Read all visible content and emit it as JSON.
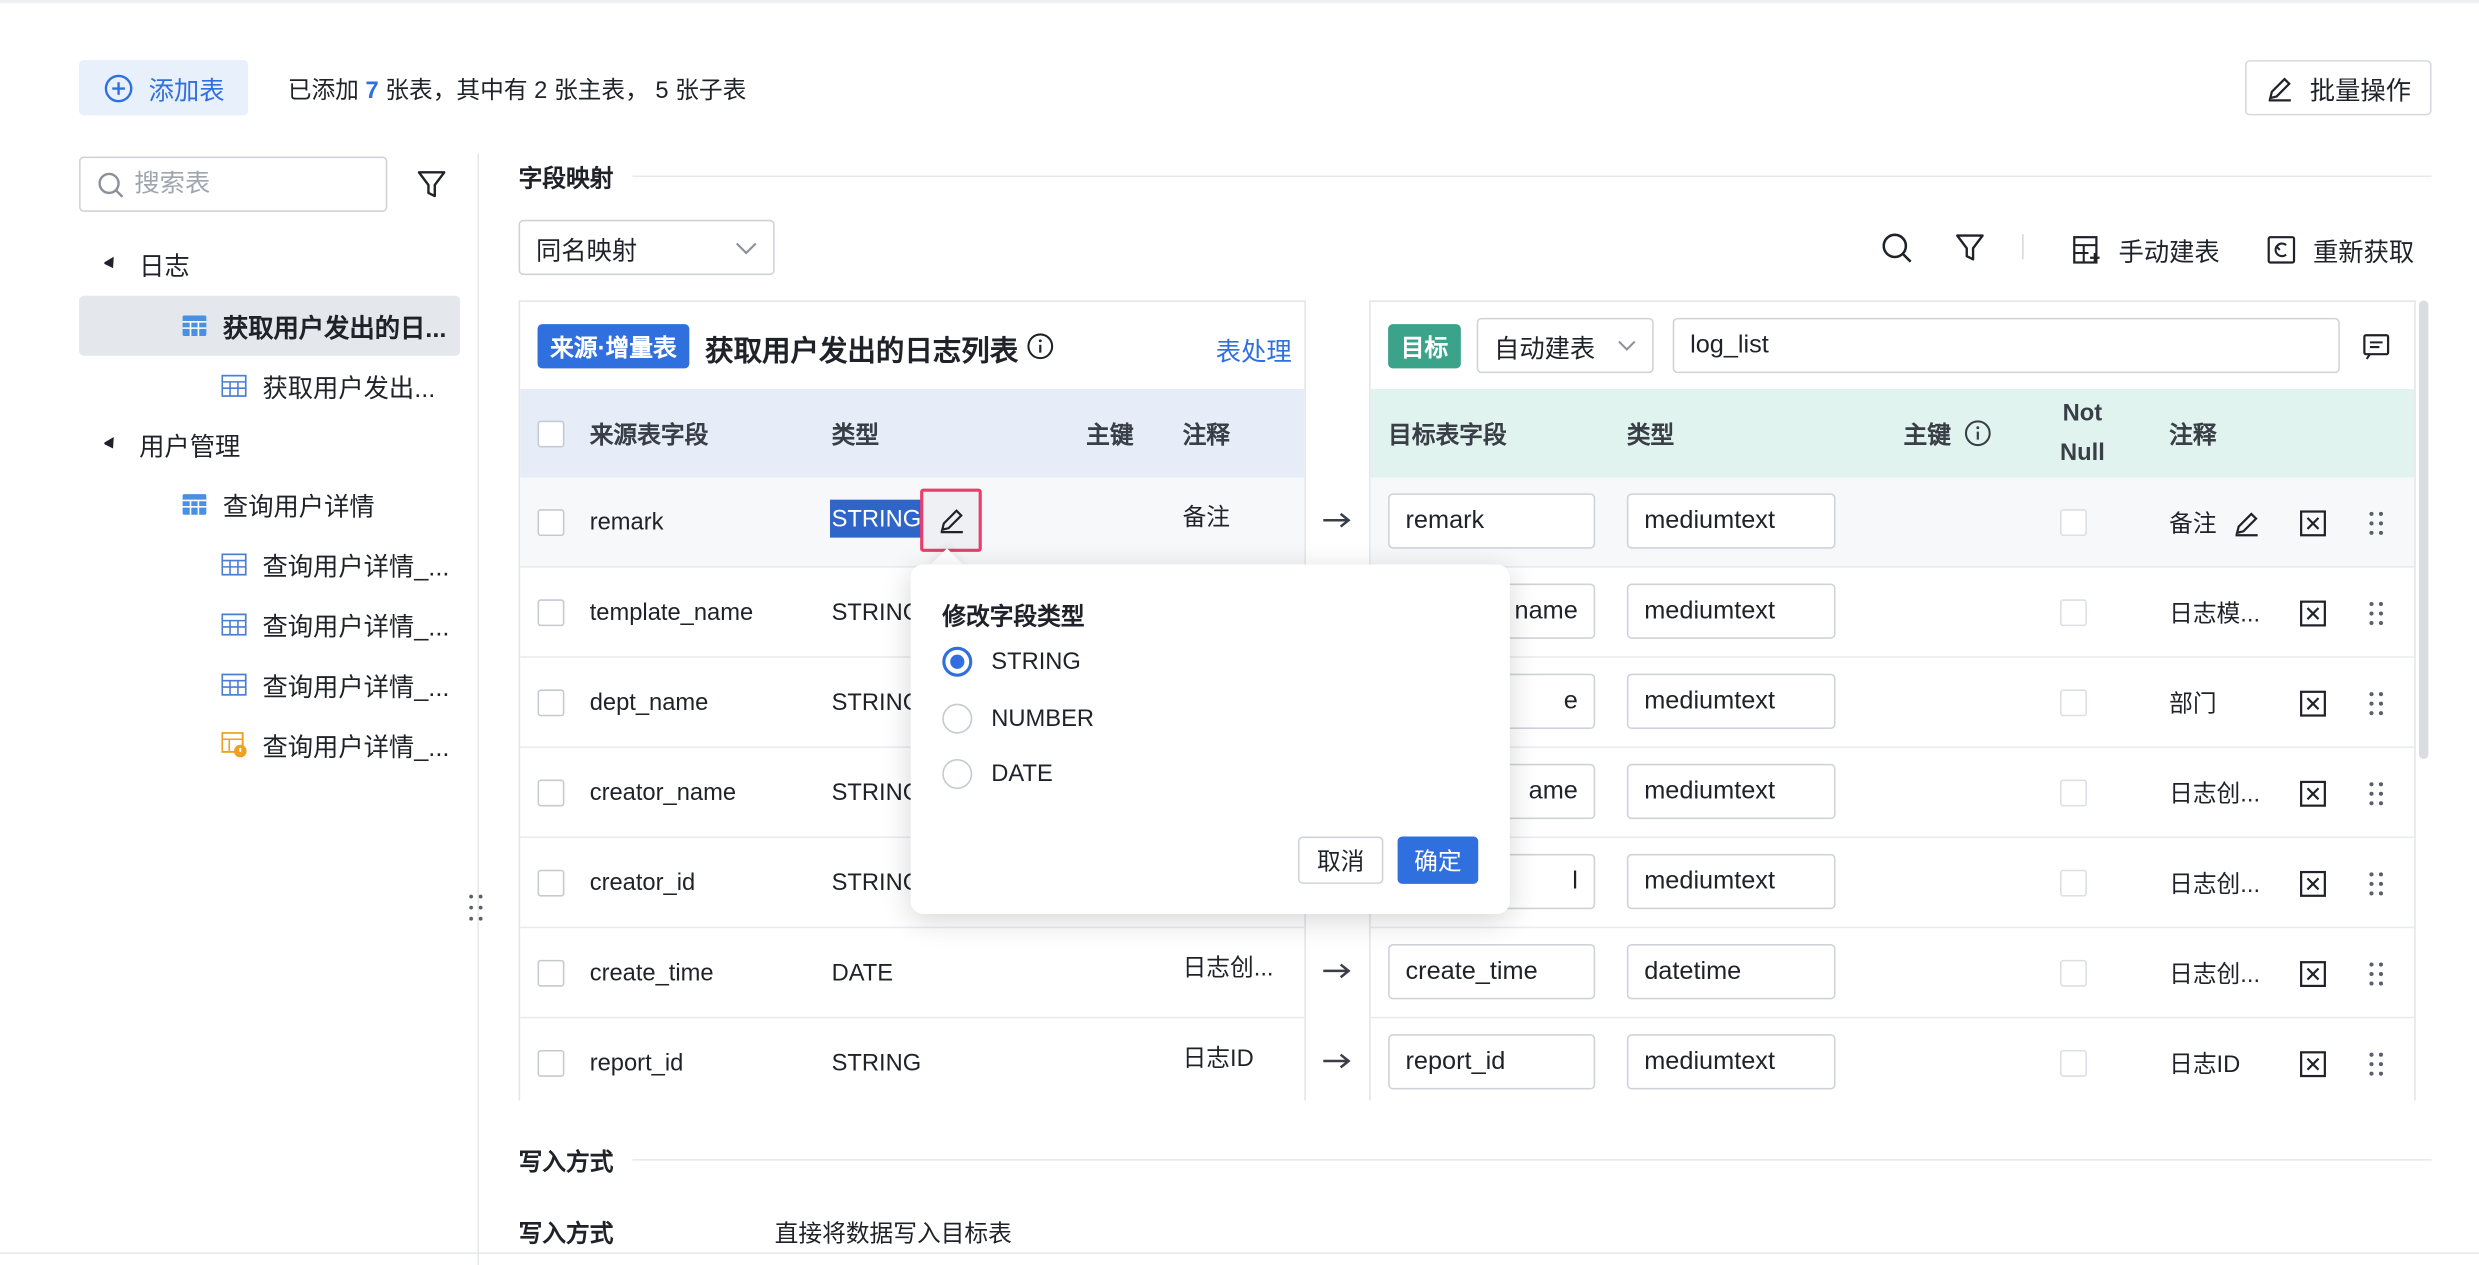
{
  "toolbar": {
    "add_label": "添加表",
    "summary_prefix": "已添加",
    "summary_count": "7",
    "summary_rest": "张表，其中有 2 张主表， 5 张子表",
    "batch_label": "批量操作"
  },
  "sidebar": {
    "search_placeholder": "搜索表",
    "groups": [
      {
        "label": "日志"
      },
      {
        "label": "用户管理"
      }
    ],
    "items": [
      {
        "label": "获取用户发出的日..."
      },
      {
        "label": "获取用户发出..."
      },
      {
        "label": "查询用户详情"
      },
      {
        "label": "查询用户详情_..."
      },
      {
        "label": "查询用户详情_..."
      },
      {
        "label": "查询用户详情_..."
      },
      {
        "label": "查询用户详情_..."
      }
    ]
  },
  "mapping": {
    "section_title": "字段映射",
    "mode": "同名映射",
    "manual_create": "手动建表",
    "refetch": "重新获取"
  },
  "source": {
    "badge": "来源·增量表",
    "title": "获取用户发出的日志列表",
    "process_link": "表处理",
    "headers": {
      "field": "来源表字段",
      "type": "类型",
      "pk": "主键",
      "comment": "注释"
    },
    "rows": [
      {
        "field": "remark",
        "type": "STRING",
        "comment": "备注"
      },
      {
        "field": "template_name",
        "type": "STRINC",
        "comment": ""
      },
      {
        "field": "dept_name",
        "type": "STRINC",
        "comment": ""
      },
      {
        "field": "creator_name",
        "type": "STRINC",
        "comment": ""
      },
      {
        "field": "creator_id",
        "type": "STRINC",
        "comment": ""
      },
      {
        "field": "create_time",
        "type": "DATE",
        "comment": "日志创..."
      },
      {
        "field": "report_id",
        "type": "STRING",
        "comment": "日志ID"
      }
    ]
  },
  "target": {
    "badge": "目标",
    "create_mode": "自动建表",
    "table_name": "log_list",
    "headers": {
      "field": "目标表字段",
      "type": "类型",
      "pk": "主键",
      "notnull_1": "Not",
      "notnull_2": "Null",
      "comment": "注释"
    },
    "rows": [
      {
        "field": "remark",
        "type": "mediumtext",
        "comment": "备注"
      },
      {
        "field": "name",
        "type": "mediumtext",
        "comment": "日志模..."
      },
      {
        "field": "e",
        "type": "mediumtext",
        "comment": "部门"
      },
      {
        "field": "ame",
        "type": "mediumtext",
        "comment": "日志创..."
      },
      {
        "field": "l",
        "type": "mediumtext",
        "comment": "日志创..."
      },
      {
        "field": "create_time",
        "type": "datetime",
        "comment": "日志创..."
      },
      {
        "field": "report_id",
        "type": "mediumtext",
        "comment": "日志ID"
      }
    ]
  },
  "popover": {
    "title": "修改字段类型",
    "options": [
      "STRING",
      "NUMBER",
      "DATE"
    ],
    "selected": "STRING",
    "cancel": "取消",
    "confirm": "确定"
  },
  "write": {
    "section_title": "写入方式",
    "label": "写入方式",
    "value": "直接将数据写入目标表"
  },
  "colors": {
    "primary": "#2f6fde",
    "source_header_bg": "#e6edf8",
    "target_header_bg": "#e1f3ee",
    "target_badge": "#3aa389",
    "highlight_border": "#e83e6c"
  }
}
